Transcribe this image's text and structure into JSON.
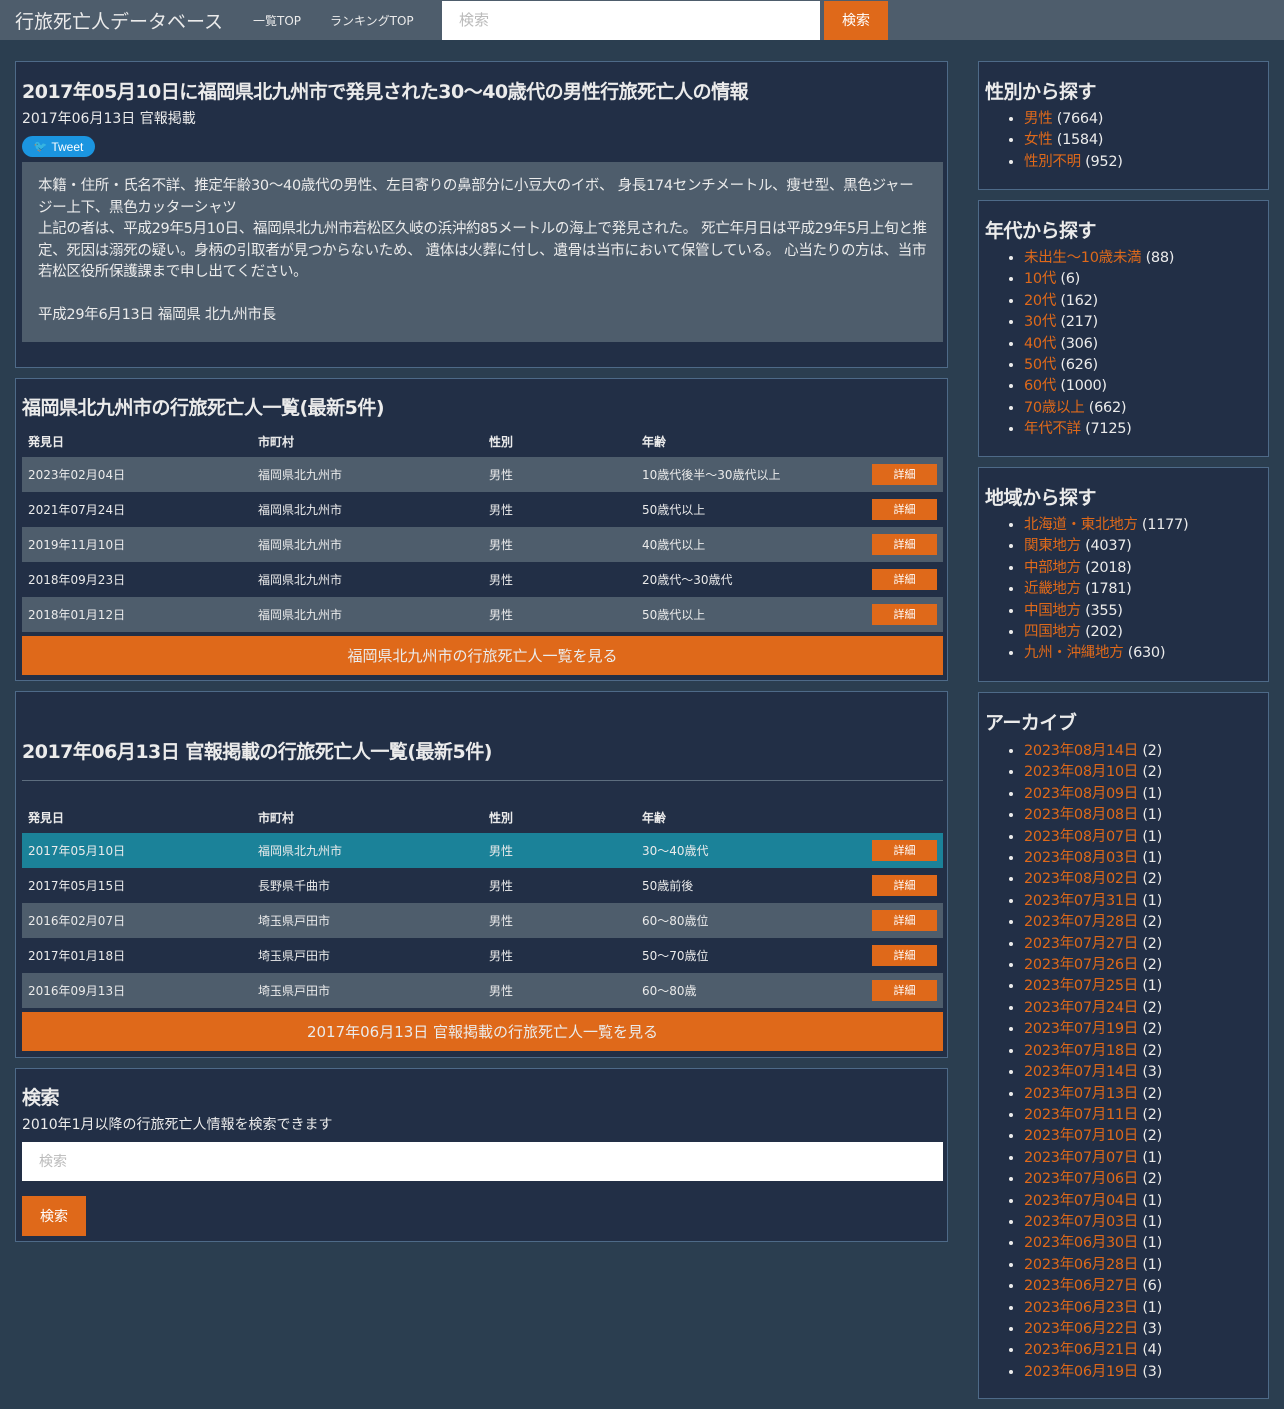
{
  "nav": {
    "brand": "行旅死亡人データベース",
    "link_list": "一覧TOP",
    "link_ranking": "ランキングTOP",
    "search_placeholder": "検索",
    "search_button": "検索"
  },
  "article": {
    "title": "2017年05月10日に福岡県北九州市で発見された30〜40歳代の男性行旅死亡人の情報",
    "published": "2017年06月13日 官報掲載",
    "tweet": "Tweet",
    "line1": "本籍・住所・氏名不詳、推定年齢30〜40歳代の男性、左目寄りの鼻部分に小豆大のイボ、 身長174センチメートル、痩せ型、黒色ジャージー上下、黒色カッターシャツ",
    "line2": "上記の者は、平成29年5月10日、福岡県北九州市若松区久岐の浜沖約85メートルの海上で発見された。 死亡年月日は平成29年5月上旬と推定、死因は溺死の疑い。身柄の引取者が見つからないため、 遺体は火葬に付し、遺骨は当市において保管している。 心当たりの方は、当市若松区役所保護課まで申し出てください。",
    "signature": "平成29年6月13日 福岡県 北九州市長"
  },
  "city_list": {
    "title": "福岡県北九州市の行旅死亡人一覧(最新5件)",
    "headers": [
      "発見日",
      "市町村",
      "性別",
      "年齢"
    ],
    "rows": [
      {
        "date": "2023年02月04日",
        "city": "福岡県北九州市",
        "sex": "男性",
        "age": "10歳代後半〜30歳代以上",
        "btn": "詳細"
      },
      {
        "date": "2021年07月24日",
        "city": "福岡県北九州市",
        "sex": "男性",
        "age": "50歳代以上",
        "btn": "詳細"
      },
      {
        "date": "2019年11月10日",
        "city": "福岡県北九州市",
        "sex": "男性",
        "age": "40歳代以上",
        "btn": "詳細"
      },
      {
        "date": "2018年09月23日",
        "city": "福岡県北九州市",
        "sex": "男性",
        "age": "20歳代〜30歳代",
        "btn": "詳細"
      },
      {
        "date": "2018年01月12日",
        "city": "福岡県北九州市",
        "sex": "男性",
        "age": "50歳代以上",
        "btn": "詳細"
      }
    ],
    "more": "福岡県北九州市の行旅死亡人一覧を見る"
  },
  "date_list": {
    "title": "2017年06月13日 官報掲載の行旅死亡人一覧(最新5件)",
    "headers": [
      "発見日",
      "市町村",
      "性別",
      "年齢"
    ],
    "rows": [
      {
        "date": "2017年05月10日",
        "city": "福岡県北九州市",
        "sex": "男性",
        "age": "30〜40歳代",
        "btn": "詳細"
      },
      {
        "date": "2017年05月15日",
        "city": "長野県千曲市",
        "sex": "男性",
        "age": "50歳前後",
        "btn": "詳細"
      },
      {
        "date": "2016年02月07日",
        "city": "埼玉県戸田市",
        "sex": "男性",
        "age": "60〜80歳位",
        "btn": "詳細"
      },
      {
        "date": "2017年01月18日",
        "city": "埼玉県戸田市",
        "sex": "男性",
        "age": "50〜70歳位",
        "btn": "詳細"
      },
      {
        "date": "2016年09月13日",
        "city": "埼玉県戸田市",
        "sex": "男性",
        "age": "60〜80歳",
        "btn": "詳細"
      }
    ],
    "more": "2017年06月13日 官報掲載の行旅死亡人一覧を見る"
  },
  "search": {
    "title": "検索",
    "desc": "2010年1月以降の行旅死亡人情報を検索できます",
    "placeholder": "検索",
    "button": "検索"
  },
  "sidebar": {
    "sex": {
      "title": "性別から探す",
      "items": [
        {
          "label": "男性",
          "count": "(7664)"
        },
        {
          "label": "女性",
          "count": "(1584)"
        },
        {
          "label": "性別不明",
          "count": "(952)"
        }
      ]
    },
    "age": {
      "title": "年代から探す",
      "items": [
        {
          "label": "未出生〜10歳未満",
          "count": "(88)"
        },
        {
          "label": "10代",
          "count": "(6)"
        },
        {
          "label": "20代",
          "count": "(162)"
        },
        {
          "label": "30代",
          "count": "(217)"
        },
        {
          "label": "40代",
          "count": "(306)"
        },
        {
          "label": "50代",
          "count": "(626)"
        },
        {
          "label": "60代",
          "count": "(1000)"
        },
        {
          "label": "70歳以上",
          "count": "(662)"
        },
        {
          "label": "年代不詳",
          "count": "(7125)"
        }
      ]
    },
    "region": {
      "title": "地域から探す",
      "items": [
        {
          "label": "北海道・東北地方",
          "count": "(1177)"
        },
        {
          "label": "関東地方",
          "count": "(4037)"
        },
        {
          "label": "中部地方",
          "count": "(2018)"
        },
        {
          "label": "近畿地方",
          "count": "(1781)"
        },
        {
          "label": "中国地方",
          "count": "(355)"
        },
        {
          "label": "四国地方",
          "count": "(202)"
        },
        {
          "label": "九州・沖縄地方",
          "count": "(630)"
        }
      ]
    },
    "archive": {
      "title": "アーカイブ",
      "items": [
        {
          "label": "2023年08月14日",
          "count": "(2)"
        },
        {
          "label": "2023年08月10日",
          "count": "(2)"
        },
        {
          "label": "2023年08月09日",
          "count": "(1)"
        },
        {
          "label": "2023年08月08日",
          "count": "(1)"
        },
        {
          "label": "2023年08月07日",
          "count": "(1)"
        },
        {
          "label": "2023年08月03日",
          "count": "(1)"
        },
        {
          "label": "2023年08月02日",
          "count": "(2)"
        },
        {
          "label": "2023年07月31日",
          "count": "(1)"
        },
        {
          "label": "2023年07月28日",
          "count": "(2)"
        },
        {
          "label": "2023年07月27日",
          "count": "(2)"
        },
        {
          "label": "2023年07月26日",
          "count": "(2)"
        },
        {
          "label": "2023年07月25日",
          "count": "(1)"
        },
        {
          "label": "2023年07月24日",
          "count": "(2)"
        },
        {
          "label": "2023年07月19日",
          "count": "(2)"
        },
        {
          "label": "2023年07月18日",
          "count": "(2)"
        },
        {
          "label": "2023年07月14日",
          "count": "(3)"
        },
        {
          "label": "2023年07月13日",
          "count": "(2)"
        },
        {
          "label": "2023年07月11日",
          "count": "(2)"
        },
        {
          "label": "2023年07月10日",
          "count": "(2)"
        },
        {
          "label": "2023年07月07日",
          "count": "(1)"
        },
        {
          "label": "2023年07月06日",
          "count": "(2)"
        },
        {
          "label": "2023年07月04日",
          "count": "(1)"
        },
        {
          "label": "2023年07月03日",
          "count": "(1)"
        },
        {
          "label": "2023年06月30日",
          "count": "(1)"
        },
        {
          "label": "2023年06月28日",
          "count": "(1)"
        },
        {
          "label": "2023年06月27日",
          "count": "(6)"
        },
        {
          "label": "2023年06月23日",
          "count": "(1)"
        },
        {
          "label": "2023年06月22日",
          "count": "(3)"
        },
        {
          "label": "2023年06月21日",
          "count": "(4)"
        },
        {
          "label": "2023年06月19日",
          "count": "(3)"
        }
      ]
    }
  }
}
